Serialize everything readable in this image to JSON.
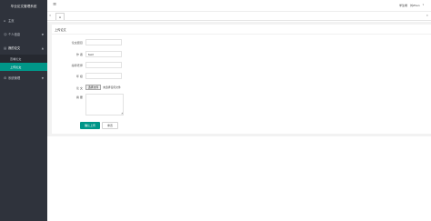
{
  "sidebar": {
    "title": "毕业论文管理系统",
    "items": [
      {
        "label": "主页",
        "icon": "home-icon"
      },
      {
        "label": "个人信息",
        "icon": "user-icon"
      },
      {
        "label": "我的论文",
        "icon": "document-icon"
      },
      {
        "label": "系统管理",
        "icon": "settings-icon"
      }
    ],
    "sub_items": [
      {
        "label": "查看论文"
      },
      {
        "label": "上传论文"
      }
    ]
  },
  "header": {
    "menu_icon": "hamburger-icon",
    "user_role": "学生端",
    "user_name": "刘Zhen"
  },
  "tabs": {
    "prev_icon": "chevron-left-icon",
    "home_icon": "home-icon",
    "next_icon": "chevron-right-icon"
  },
  "form": {
    "title": "上传论文",
    "fields": [
      {
        "label": "论文题目",
        "value": ""
      },
      {
        "label": "作 者",
        "value": "test"
      },
      {
        "label": "指导老师",
        "value": ""
      },
      {
        "label": "年 级",
        "value": ""
      },
      {
        "label": "论 文",
        "file_button": "选择文件",
        "file_status": "未选择任何文件"
      },
      {
        "label": "摘 要",
        "value": ""
      }
    ],
    "submit_label": "确认上传",
    "reset_label": "重置"
  },
  "colors": {
    "sidebar_bg": "#2f333c",
    "accent": "#009688"
  }
}
